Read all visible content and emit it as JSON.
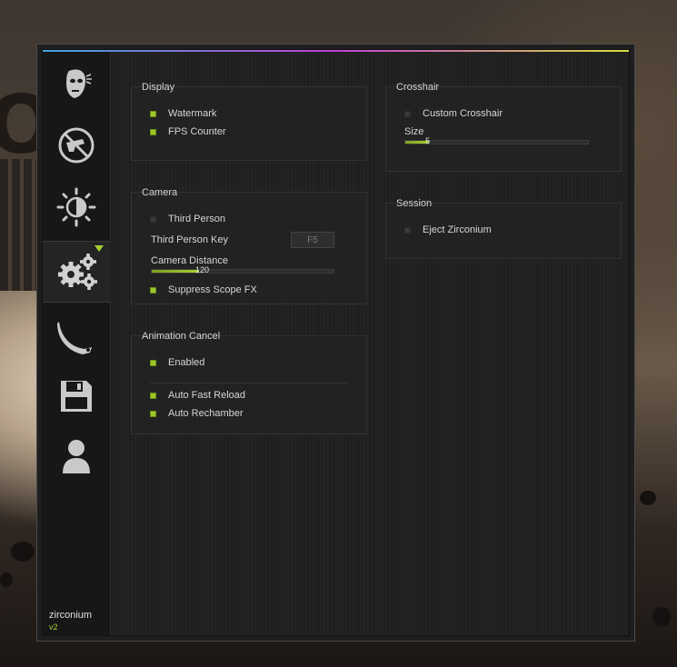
{
  "sidebar": {
    "tabs": [
      {
        "icon": "mask-icon"
      },
      {
        "icon": "no-aim-icon"
      },
      {
        "icon": "brightness-icon"
      },
      {
        "icon": "gears-icon",
        "active": true
      },
      {
        "icon": "knife-icon"
      },
      {
        "icon": "save-icon"
      },
      {
        "icon": "user-icon"
      }
    ],
    "brand": "zirconium",
    "version": "v2"
  },
  "display": {
    "title": "Display",
    "watermark": {
      "label": "Watermark",
      "checked": true
    },
    "fps_counter": {
      "label": "FPS Counter",
      "checked": true
    }
  },
  "camera": {
    "title": "Camera",
    "third_person": {
      "label": "Third Person",
      "checked": false
    },
    "third_person_key": {
      "label": "Third Person Key",
      "value": "F5"
    },
    "camera_distance": {
      "label": "Camera Distance",
      "value": "120",
      "fill": 0.26
    },
    "suppress_scope_fx": {
      "label": "Suppress Scope FX",
      "checked": true
    }
  },
  "animation_cancel": {
    "title": "Animation Cancel",
    "enabled": {
      "label": "Enabled",
      "checked": true
    },
    "auto_fast_reload": {
      "label": "Auto Fast Reload",
      "checked": true
    },
    "auto_rechamber": {
      "label": "Auto Rechamber",
      "checked": true
    }
  },
  "crosshair": {
    "title": "Crosshair",
    "custom_crosshair": {
      "label": "Custom Crosshair",
      "checked": false
    },
    "size": {
      "label": "Size",
      "value": "5",
      "fill": 0.13
    }
  },
  "session": {
    "title": "Session",
    "eject": {
      "label": "Eject Zirconium",
      "checked": false
    }
  },
  "colors": {
    "accent": "#a7d130"
  }
}
